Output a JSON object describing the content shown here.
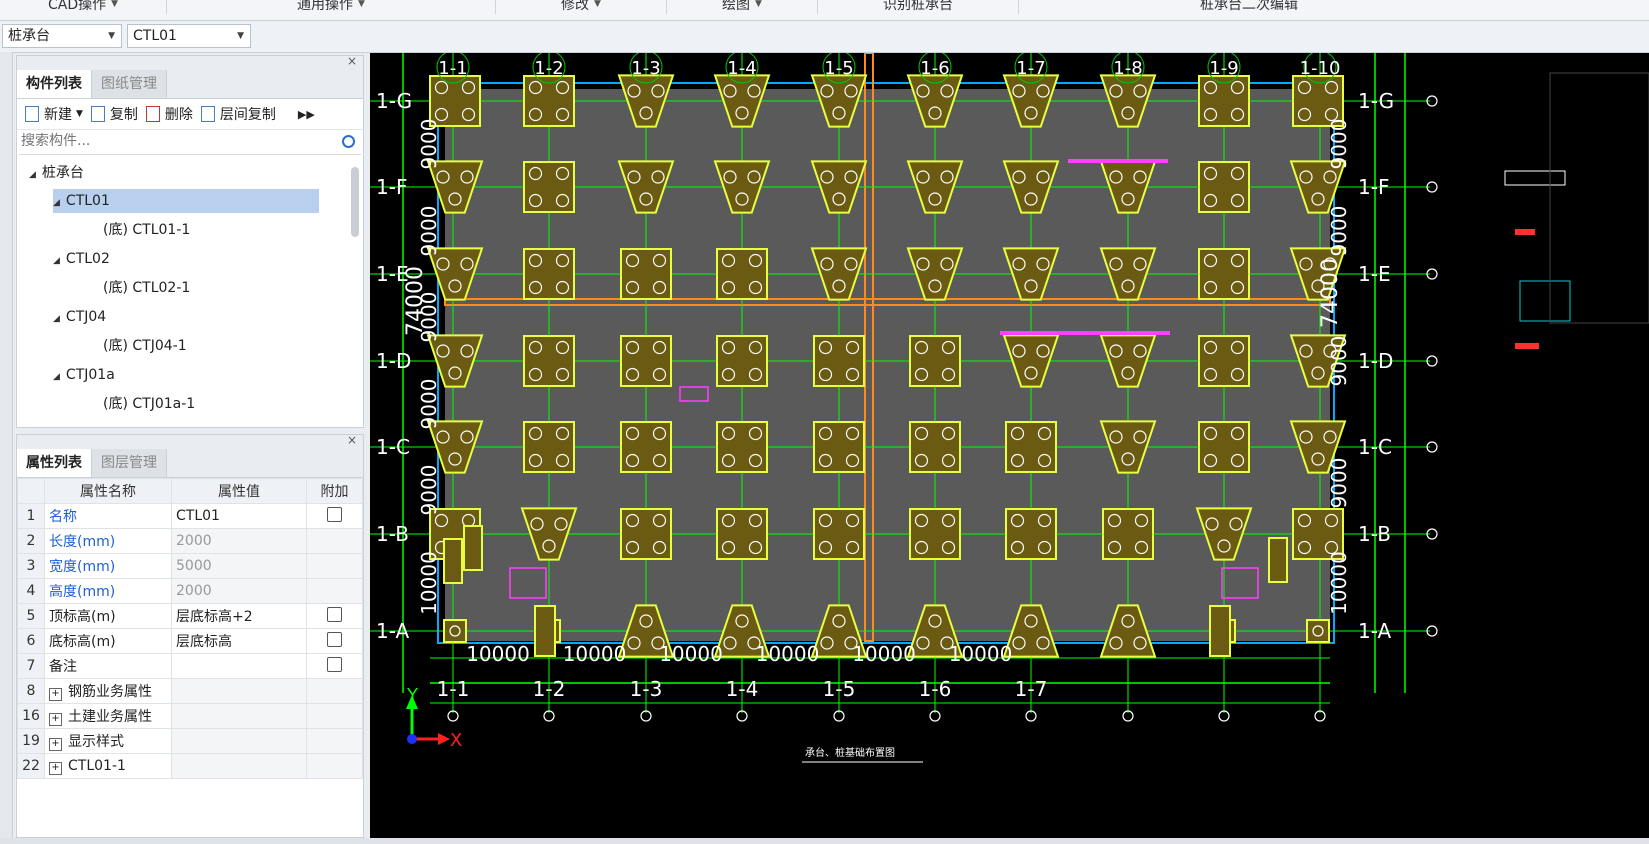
{
  "ribbon": {
    "groups": [
      "CAD操作",
      "通用操作",
      "修改",
      "绘图",
      "识别桩承台",
      "桩承台二次编辑"
    ]
  },
  "selector": {
    "category": "桩承台",
    "component": "CTL01"
  },
  "component_panel": {
    "tabs": [
      "构件列表",
      "图纸管理"
    ],
    "toolbar": [
      "新建",
      "复制",
      "删除",
      "层间复制"
    ],
    "search_placeholder": "搜索构件...",
    "tree": {
      "root": "桩承台",
      "items": [
        {
          "label": "CTL01",
          "child": "(底) CTL01-1"
        },
        {
          "label": "CTL02",
          "child": "(底) CTL02-1"
        },
        {
          "label": "CTJ04",
          "child": "(底) CTJ04-1"
        },
        {
          "label": "CTJ01a",
          "child": "(底) CTJ01a-1"
        }
      ]
    }
  },
  "property_panel": {
    "tabs": [
      "属性列表",
      "图层管理"
    ],
    "headers": [
      "属性名称",
      "属性值",
      "附加"
    ],
    "rows": [
      {
        "num": "1",
        "name": "名称",
        "value": "CTL01",
        "style": "blue",
        "check": true
      },
      {
        "num": "2",
        "name": "长度(mm)",
        "value": "2000",
        "style": "blue-grey",
        "check": false
      },
      {
        "num": "3",
        "name": "宽度(mm)",
        "value": "5000",
        "style": "blue-grey",
        "check": false
      },
      {
        "num": "4",
        "name": "高度(mm)",
        "value": "2000",
        "style": "blue-grey",
        "check": false
      },
      {
        "num": "5",
        "name": "顶标高(m)",
        "value": "层底标高+2",
        "style": "",
        "check": true
      },
      {
        "num": "6",
        "name": "底标高(m)",
        "value": "层底标高",
        "style": "",
        "check": true
      },
      {
        "num": "7",
        "name": "备注",
        "value": "",
        "style": "",
        "check": true
      },
      {
        "num": "8",
        "name": "钢筋业务属性",
        "value": "",
        "style": "group",
        "check": false
      },
      {
        "num": "16",
        "name": "土建业务属性",
        "value": "",
        "style": "group",
        "check": false
      },
      {
        "num": "19",
        "name": "显示样式",
        "value": "",
        "style": "group",
        "check": false
      },
      {
        "num": "22",
        "name": "CTL01-1",
        "value": "",
        "style": "group",
        "check": false
      }
    ]
  },
  "drawing": {
    "columns": [
      "1-1",
      "1-2",
      "1-3",
      "1-4",
      "1-5",
      "1-6",
      "1-7",
      "1-8",
      "1-9",
      "1-10"
    ],
    "bottom_columns": [
      "1-1",
      "1-2",
      "1-3",
      "1-4",
      "1-5",
      "1-6",
      "1-7"
    ],
    "rows": [
      "1-G",
      "1-F",
      "1-E",
      "1-D",
      "1-C",
      "1-B",
      "1-A"
    ],
    "left_dims": [
      "9000",
      "9000",
      "9000",
      "9000",
      "9000",
      "10000"
    ],
    "left_total": "74000",
    "right_dims": [
      "9000",
      "9000",
      "9000",
      "9000",
      "10000"
    ],
    "right_total": "74000",
    "bottom_dims": [
      "10000",
      "10000",
      "10000",
      "10000",
      "10000",
      "10000"
    ],
    "axis_x": "X",
    "axis_y": "Y",
    "title_block": "承台、桩基础布置图",
    "colors": {
      "background": "#000000",
      "cap_fill": "#6b5b12",
      "cap_outline": "#e8ff40",
      "grid": "#00ff00",
      "slab": "#5a5a5a"
    }
  }
}
